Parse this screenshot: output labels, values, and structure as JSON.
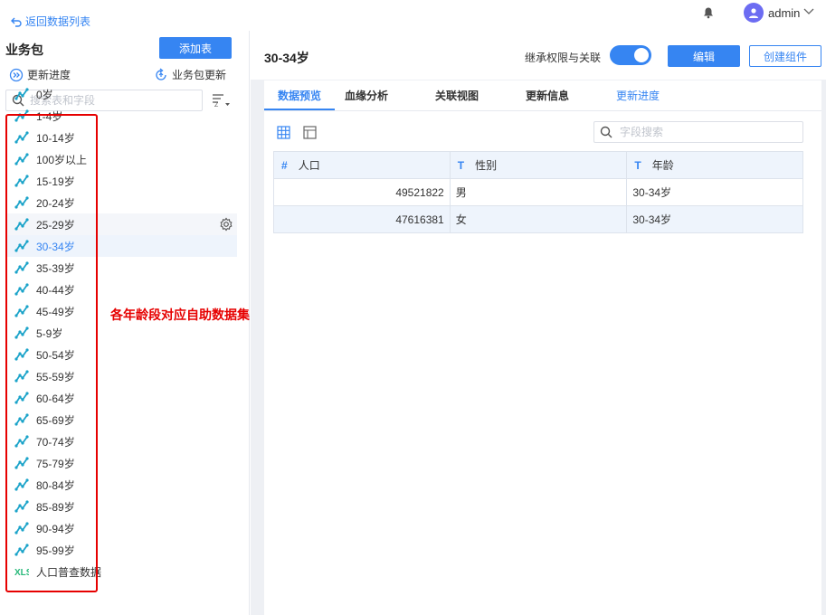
{
  "topbar": {
    "back_label": "返回数据列表",
    "username": "admin"
  },
  "left": {
    "title": "业务包",
    "add_button": "添加表",
    "progress_label": "更新进度",
    "package_update_label": "业务包更新",
    "search_placeholder": "搜索表和字段",
    "items": [
      "0岁",
      "1-4岁",
      "10-14岁",
      "100岁以上",
      "15-19岁",
      "20-24岁",
      "25-29岁",
      "30-34岁",
      "35-39岁",
      "40-44岁",
      "45-49岁",
      "5-9岁",
      "50-54岁",
      "55-59岁",
      "60-64岁",
      "65-69岁",
      "70-74岁",
      "75-79岁",
      "80-84岁",
      "85-89岁",
      "90-94岁",
      "95-99岁",
      "人口普查数据"
    ],
    "annotation": "各年龄段对应自助数据集"
  },
  "main": {
    "title": "30-34岁",
    "inherit_label": "继承权限与关联",
    "inherit_enabled": true,
    "edit_button": "编辑",
    "create_button": "创建组件",
    "tabs": [
      "数据预览",
      "血缘分析",
      "关联视图",
      "更新信息",
      "更新进度"
    ],
    "field_search_placeholder": "字段搜索",
    "columns": [
      {
        "type": "#",
        "name": "人口"
      },
      {
        "type": "T",
        "name": "性别"
      },
      {
        "type": "T",
        "name": "年龄"
      }
    ],
    "rows": [
      [
        "49521822",
        "男",
        "30-34岁"
      ],
      [
        "47616381",
        "女",
        "30-34岁"
      ]
    ]
  },
  "colors": {
    "accent": "#3685f2",
    "annotation": "#e60000",
    "header_bg": "#eef4fc"
  }
}
